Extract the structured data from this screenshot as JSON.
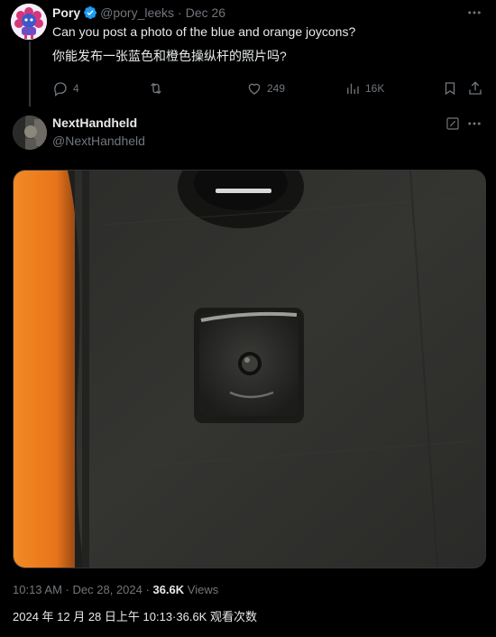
{
  "parent_tweet": {
    "author_name": "Pory",
    "handle": "@pory_leeks",
    "separator": "·",
    "date": "Dec 26",
    "text": "Can you post a photo of the blue and orange joycons?",
    "translation": "你能发布一张蓝色和橙色操纵杆的照片吗?",
    "actions": {
      "replies": "4",
      "retweets": "",
      "likes": "249",
      "views": "16K"
    }
  },
  "main_tweet": {
    "author_name": "NextHandheld",
    "handle": "@NextHandheld",
    "time": "10:13 AM",
    "meta_sep": "·",
    "date": "Dec 28, 2024",
    "views_count": "36.6K",
    "views_label": "Views",
    "translated_meta": "2024 年 12 月 28 日上午 10:13·36.6K 观看次数"
  },
  "icons": {
    "verified": "verified-badge-icon",
    "more": "more-options-icon",
    "reply": "reply-icon",
    "retweet": "retweet-icon",
    "like": "heart-icon",
    "views": "views-bar-chart-icon",
    "bookmark": "bookmark-icon",
    "share": "share-icon",
    "edit": "edit-icon"
  },
  "colors": {
    "background": "#000000",
    "primary_text": "#e7e9ea",
    "secondary_text": "#71767b",
    "verified_blue": "#1d9bf0",
    "joycon_orange": "#f5821f",
    "device_dark": "#2e2e2e"
  }
}
